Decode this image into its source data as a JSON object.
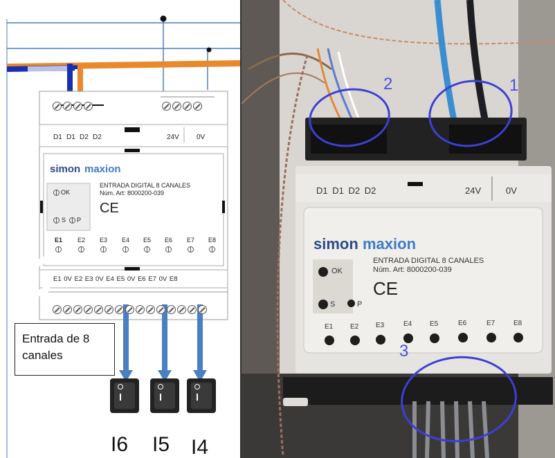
{
  "left_diagram": {
    "top_terminal_labels": [
      "D1",
      "D1",
      "D2",
      "D2",
      "24V",
      "0V"
    ],
    "brand": {
      "part1": "simon",
      "part2": "maxion"
    },
    "product_title": "ENTRADA DIGITAL 8 CANALES",
    "article_number": "Núm. Art: 8000200-039",
    "ce_mark": "CE",
    "led_labels": {
      "ok": "OK",
      "s": "S",
      "p": "P"
    },
    "channel_labels": [
      "E1",
      "E2",
      "E3",
      "E4",
      "E5",
      "E6",
      "E7",
      "E8"
    ],
    "bottom_terminal_labels": "E1 0V E2 E3 0V E4 E5 0V E6 E7 0V E8",
    "callout": "Entrada de 8 canales",
    "switch_labels": [
      "I6",
      "I5",
      "I4"
    ]
  },
  "photo": {
    "top_terminal_labels": "D1 D1 D2 D2",
    "voltage_labels": [
      "24V",
      "0V"
    ],
    "brand": {
      "part1": "simon",
      "part2": "maxion"
    },
    "product_title": "ENTRADA DIGITAL 8 CANALES",
    "article_number": "Núm. Art: 8000200-039",
    "ce_mark": "CE",
    "led_labels": {
      "ok": "OK",
      "s": "S",
      "p": "P"
    },
    "channel_labels": [
      "E1",
      "E2",
      "E3",
      "E4",
      "E5",
      "E6",
      "E7",
      "E8"
    ],
    "markers": [
      "1",
      "2",
      "3"
    ]
  },
  "colors": {
    "marker": "#3d3fd6",
    "arrow": "#4a7fc1",
    "wire_orange": "#e8892b",
    "wire_blue": "#1a2fb0"
  }
}
